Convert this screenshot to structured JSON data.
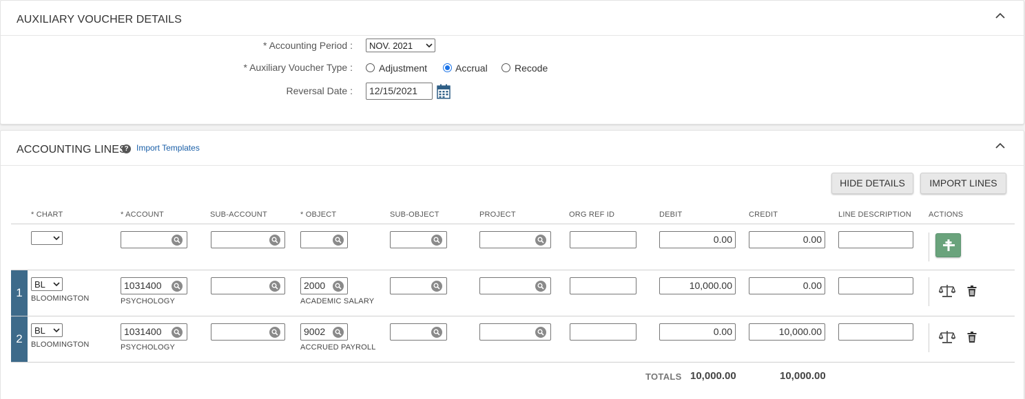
{
  "voucher_panel": {
    "title": "AUXILIARY VOUCHER DETAILS",
    "accounting_period_label": "* Accounting Period :",
    "accounting_period_value": "NOV. 2021",
    "voucher_type_label": "* Auxiliary Voucher Type :",
    "voucher_type_options": [
      "Adjustment",
      "Accrual",
      "Recode"
    ],
    "voucher_type_selected": "Accrual",
    "reversal_date_label": "Reversal Date :",
    "reversal_date_value": "12/15/2021"
  },
  "lines_panel": {
    "title": "ACCOUNTING LINES",
    "help_icon": "?",
    "import_templates_link": "Import Templates",
    "hide_details_button": "HIDE DETAILS",
    "import_lines_button": "IMPORT LINES",
    "columns": [
      "* CHART",
      "* ACCOUNT",
      "SUB-ACCOUNT",
      "* OBJECT",
      "SUB-OBJECT",
      "PROJECT",
      "ORG REF ID",
      "DEBIT",
      "CREDIT",
      "LINE DESCRIPTION",
      "ACTIONS"
    ],
    "new_line": {
      "chart": "",
      "account": "",
      "sub_account": "",
      "object": "",
      "sub_object": "",
      "project": "",
      "org_ref_id": "",
      "debit": "0.00",
      "credit": "0.00",
      "line_description": ""
    },
    "lines": [
      {
        "number": "1",
        "chart": "BL",
        "chart_name": "BLOOMINGTON",
        "account": "1031400",
        "account_name": "PSYCHOLOGY",
        "sub_account": "",
        "object": "2000",
        "object_name": "ACADEMIC SALARY",
        "sub_object": "",
        "project": "",
        "org_ref_id": "",
        "debit": "10,000.00",
        "credit": "0.00",
        "line_description": ""
      },
      {
        "number": "2",
        "chart": "BL",
        "chart_name": "BLOOMINGTON",
        "account": "1031400",
        "account_name": "PSYCHOLOGY",
        "sub_account": "",
        "object": "9002",
        "object_name": "ACCRUED PAYROLL",
        "sub_object": "",
        "project": "",
        "org_ref_id": "",
        "debit": "0.00",
        "credit": "10,000.00",
        "line_description": ""
      }
    ],
    "totals_label": "TOTALS",
    "total_debit": "10,000.00",
    "total_credit": "10,000.00"
  },
  "icons": {
    "collapse": "chevron-up-icon",
    "search": "search-icon",
    "calendar": "calendar-icon",
    "add": "plus-icon",
    "balance": "balance-scale-icon",
    "delete": "trash-icon"
  },
  "colors": {
    "accent_blue": "#1a73e8",
    "row_number_bg": "#3d6a8a",
    "add_button_bg": "#6aa37c",
    "link": "#1a5fa8"
  }
}
